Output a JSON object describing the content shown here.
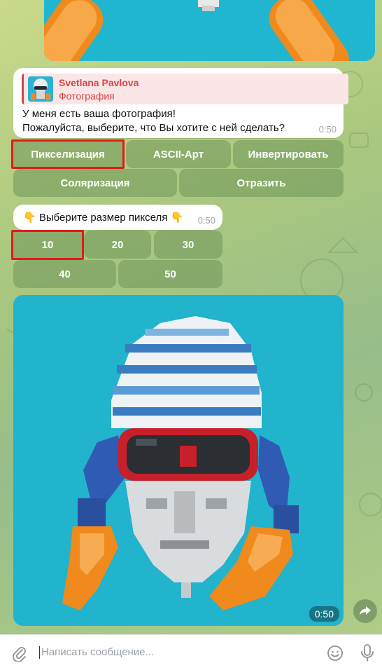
{
  "message": {
    "reply_name": "Svetlana Pavlova",
    "reply_text": "Фотография",
    "text": "У меня есть ваша фотография!\nПожалуйста, выберите, что Вы хотите с ней сделать?",
    "time": "0:50"
  },
  "keyboard1": [
    "Пикселизация",
    "ASCII-Арт",
    "Инвертировать",
    "Соляризация",
    "Отразить"
  ],
  "prompt": {
    "text": "👇 Выберите размер пикселя 👇",
    "time": "0:50"
  },
  "keyboard2": [
    "10",
    "20",
    "30",
    "40",
    "50"
  ],
  "photo": {
    "time": "0:50"
  },
  "input": {
    "placeholder": "Написать сообщение..."
  },
  "colors": {
    "accent_red": "#d64545",
    "highlight": "#e01b1b",
    "photo_bg": "#22b3cd"
  },
  "icons": [
    "attach-icon",
    "emoji-icon",
    "microphone-icon",
    "share-icon"
  ]
}
